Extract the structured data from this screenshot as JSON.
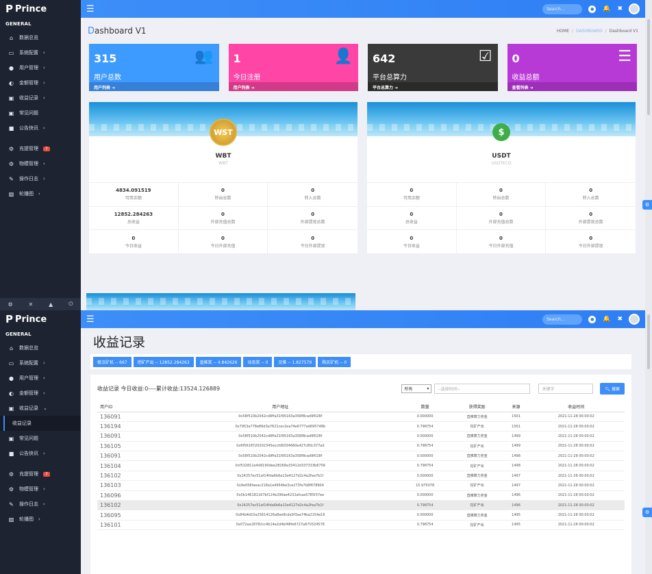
{
  "brand": {
    "name": "Prince"
  },
  "sidebar": {
    "section": "GENERAL",
    "items": [
      {
        "icon": "home-icon",
        "glyph": "⌂",
        "label": "数据总览"
      },
      {
        "icon": "monitor-icon",
        "glyph": "▭",
        "label": "系统配置"
      },
      {
        "icon": "user-icon",
        "glyph": "●",
        "label": "用户管理"
      },
      {
        "icon": "wallet-icon",
        "glyph": "◐",
        "label": "金额管理"
      },
      {
        "icon": "record-icon",
        "glyph": "▣",
        "label": "收益记录"
      },
      {
        "icon": "question-icon",
        "glyph": "▣",
        "label": "常见问题"
      },
      {
        "icon": "notice-icon",
        "glyph": "■",
        "label": "公告快讯"
      },
      {
        "icon": "miner-icon",
        "glyph": "⚙",
        "label": "充提管理",
        "badge": "7"
      },
      {
        "icon": "miner2-icon",
        "glyph": "⚙",
        "label": "物模管理"
      },
      {
        "icon": "log-icon",
        "glyph": "✎",
        "label": "操作日志"
      },
      {
        "icon": "image-icon",
        "glyph": "▨",
        "label": "轮播图"
      }
    ],
    "sub_item": "收益记录"
  },
  "topbar": {
    "search_placeholder": "Search..."
  },
  "dashboard": {
    "title_first": "D",
    "title_rest": "ashboard V1",
    "breadcrumb": {
      "home": "HOME",
      "mid": "DASHBOARD",
      "current": "Dashboard V1"
    },
    "cards": [
      {
        "num": "315",
        "label": "用户总数",
        "link": "用户列表"
      },
      {
        "num": "1",
        "label": "今日注册",
        "link": "用户列表"
      },
      {
        "num": "642",
        "label": "平台总算力",
        "link": "平台总算力"
      },
      {
        "num": "0",
        "label": "收益总额",
        "link": "查看列表"
      }
    ],
    "coins": [
      {
        "logo": "WST",
        "name": "WBT",
        "sub": "WBT",
        "cells": [
          [
            "4834.091519",
            "可用余额"
          ],
          [
            "0",
            "转出总数"
          ],
          [
            "0",
            "转入总数"
          ],
          [
            "12852.284263",
            "总收益"
          ],
          [
            "0",
            "外部充值总数"
          ],
          [
            "0",
            "外部提现总数"
          ],
          [
            "0",
            "今日收益"
          ],
          [
            "0",
            "今日外部充值"
          ],
          [
            "0",
            "今日外部提现"
          ]
        ]
      },
      {
        "logo": "$",
        "name": "USDT",
        "sub": "USDTECO",
        "cells": [
          [
            "0",
            "可用余额"
          ],
          [
            "0",
            "转出总数"
          ],
          [
            "0",
            "转入总数"
          ],
          [
            "0",
            "总收益"
          ],
          [
            "0",
            "外部充值总数"
          ],
          [
            "0",
            "外部提现总数"
          ],
          [
            "0",
            "今日收益"
          ],
          [
            "0",
            "今日外部充值"
          ],
          [
            "0",
            "今日外部提现"
          ]
        ]
      }
    ]
  },
  "records": {
    "title": "收益记录",
    "tabs": [
      "极汉矿机 -- 667",
      "挖矿产出 -- 12852.284263",
      "直推奖 -- 4.842626",
      "动态奖 -- 0",
      "见推 -- 1.827579",
      "购买矿机 -- 0"
    ],
    "summary": "收益记录 今日收益:0----累计收益:13524.126889",
    "filter": {
      "select": "所有",
      "time_placeholder": "--选择时间--",
      "keyword_placeholder": "关键字",
      "search": "搜索"
    },
    "columns": [
      "用户ID",
      "用户地址",
      "数量",
      "获得奖励",
      "来源",
      "收益时间"
    ],
    "rows": [
      [
        "136091",
        "0x58f510b2042cd9ffa31f95163a358f8cad9f028f",
        "0.000000",
        "直推算力奖金",
        "1501",
        "2021-11-28 00:00:02"
      ],
      [
        "136194",
        "0x7953a778e86d3a7621cec2ea74e6777ad695748b",
        "0.798754",
        "挖矿产出",
        "1501",
        "2021-11-28 00:00:02"
      ],
      [
        "136091",
        "0x58f510b2042cd9ffa31f95163a358f8cad9f028f",
        "0.000000",
        "直推算力奖金",
        "1499",
        "2021-11-28 00:00:02"
      ],
      [
        "136105",
        "0x6f5618720202345eccfd9334660e427c80c377ad",
        "0.798754",
        "挖矿产出",
        "1499",
        "2021-11-28 00:00:02"
      ],
      [
        "136091",
        "0x58f510b2042cd9ffa31f95163a358f8cad9f028f",
        "0.000000",
        "直推算力奖金",
        "1498",
        "2021-11-28 00:00:02"
      ],
      [
        "136104",
        "0xf532811e4d9190dee28268a33412d337333b6756",
        "0.798754",
        "挖矿产出",
        "1498",
        "2021-11-28 00:00:02"
      ],
      [
        "136102",
        "0x14257ec51af14fda6b6a13e4127d2c4a2fea7b1f",
        "0.000000",
        "直推算力奖金",
        "1497",
        "2021-11-28 00:00:02"
      ],
      [
        "136103",
        "0x9e056faeac218a1a4954be3ce273fe7b8f678904",
        "15.975078",
        "挖矿产出",
        "1497",
        "2021-11-28 00:00:02"
      ],
      [
        "136096",
        "0x5b146181167bf124e296ae4232afcaa5785f37ee",
        "0.000000",
        "直推算力奖金",
        "1496",
        "2021-11-28 00:00:02"
      ],
      [
        "136102",
        "0x14257ec51af14fda6b6a13e4127d2c4a2fea7b1f",
        "0.798754",
        "挖矿产出",
        "1496",
        "2021-11-28 00:00:02"
      ],
      [
        "136095",
        "0x84b4d10a25614126a8ee8cde0f3aa74ba2154a16",
        "0.000000",
        "直推算力奖金",
        "1495",
        "2021-11-28 00:00:02"
      ],
      [
        "136101",
        "0x072aa18782cc4b14e2d4bf48fe6727a670324578",
        "0.798754",
        "挖矿产出",
        "1495",
        "2021-11-28 00:00:02"
      ]
    ],
    "highlight_row": 9
  },
  "colors": {
    "accent": "#3d8ef8",
    "sidebar": "#1d2331"
  }
}
